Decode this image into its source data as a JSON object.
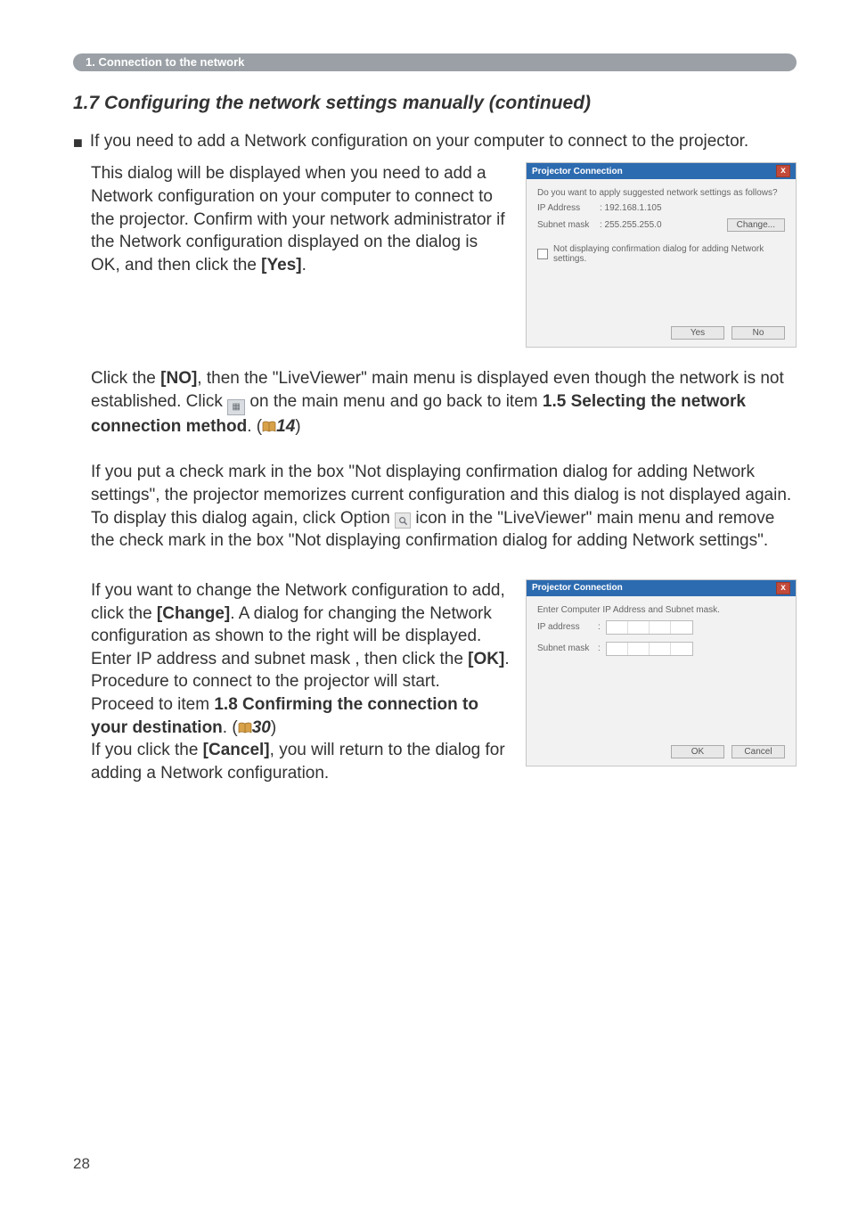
{
  "section_pill": "1. Connection to the network",
  "heading": "1.7 Configuring the network settings manually (continued)",
  "bullet_mark": "■",
  "intro": "If you need to add a Network configuration on your computer to connect to the projector.",
  "para1_a": "This dialog will be displayed when you need to add a Network configuration on your computer to connect to the projector. Confirm with your network administrator if the Network configuration displayed on the dialog is OK, and then click the ",
  "para1_yes": "[Yes]",
  "para1_dot": ".",
  "dlg1": {
    "title": "Projector Connection",
    "close": "x",
    "q": "Do you want to apply suggested network settings as follows?",
    "ip_label": "IP Address",
    "ip_value": ": 192.168.1.105",
    "sm_label": "Subnet mask",
    "sm_value": ": 255.255.255.0",
    "change_btn": "Change...",
    "chk_label": "Not displaying confirmation dialog for adding Network settings.",
    "yes": "Yes",
    "no": "No"
  },
  "para2_a": "Click the ",
  "para2_no": "[NO]",
  "para2_b": ", then the \"LiveViewer\" main menu is displayed even though the network is not established. Click ",
  "para2_c": " on the main menu and go back to item ",
  "para2_ref_bold": "1.5 Selecting the network connection method",
  "para2_dot": ". (",
  "para2_page": "14",
  "para2_close": ")",
  "para3": "If you put a check mark in the box \"Not displaying confirmation dialog for adding Network settings\", the projector memorizes current configuration and this dialog is not displayed again. To display this dialog again, click Option ",
  "para3_b": " icon in the \"LiveViewer\" main menu and remove the check mark in the box \"Not displaying confirmation dialog for adding Network settings\".",
  "para4_a": "If you want to change the Network configuration to add, click the ",
  "para4_change": "[Change]",
  "para4_b": ". A dialog for changing the Network configuration as shown to the right will be displayed. Enter IP address and subnet mask , then click the ",
  "para4_ok": "[OK]",
  "para4_c": ". Procedure to connect to the projector will start.",
  "para4_proceed_a": "Proceed to item ",
  "para4_proceed_bold": "1.8 Confirming the connection to your destination",
  "para4_proceed_dot": ". (",
  "para4_page": "30",
  "para4_close": ")",
  "para4_cancel_a": "If you click the ",
  "para4_cancel": "[Cancel]",
  "para4_cancel_b": ", you will return to the dialog for adding a Network configuration.",
  "dlg2": {
    "title": "Projector Connection",
    "close": "x",
    "q": "Enter Computer IP Address and Subnet mask.",
    "ip_label": "IP address",
    "sep": ":",
    "sm_label": "Subnet mask",
    "ok": "OK",
    "cancel": "Cancel"
  },
  "page_number": "28"
}
